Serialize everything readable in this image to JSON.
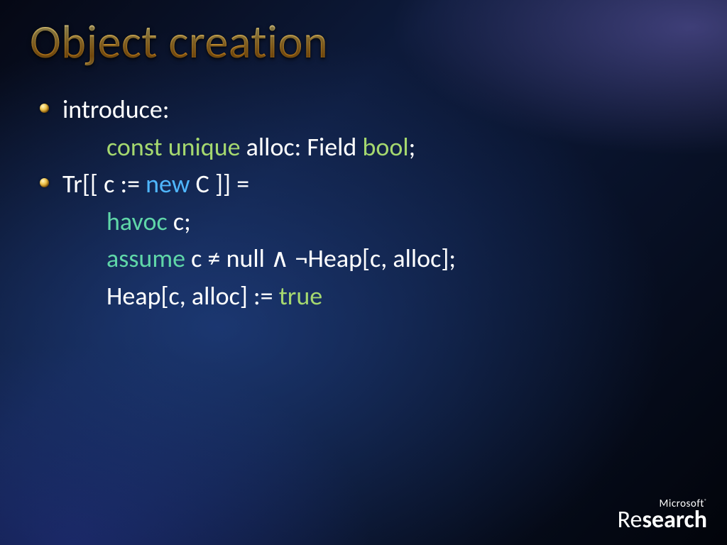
{
  "title": "Object creation",
  "bullets": {
    "b1": {
      "lead": "introduce:",
      "line1": {
        "kw1": "const unique",
        "txt1": " alloc: Field ",
        "kw2": "bool",
        "tail": ";"
      }
    },
    "b2": {
      "lead": {
        "pre": "Tr[[ c := ",
        "kw": "new",
        "post": " C ]] ="
      },
      "line1": {
        "kw": "havoc",
        "txt": " c;"
      },
      "line2": {
        "kw": "assume",
        "txt": " c ≠ null ∧ ¬Heap[c, alloc];"
      },
      "line3": {
        "pre": "Heap[c, alloc] := ",
        "kw": "true"
      }
    }
  },
  "footer": {
    "ms": "Microsoft",
    "reg": "®",
    "research_prefix": "Re",
    "research_bold": "search"
  }
}
